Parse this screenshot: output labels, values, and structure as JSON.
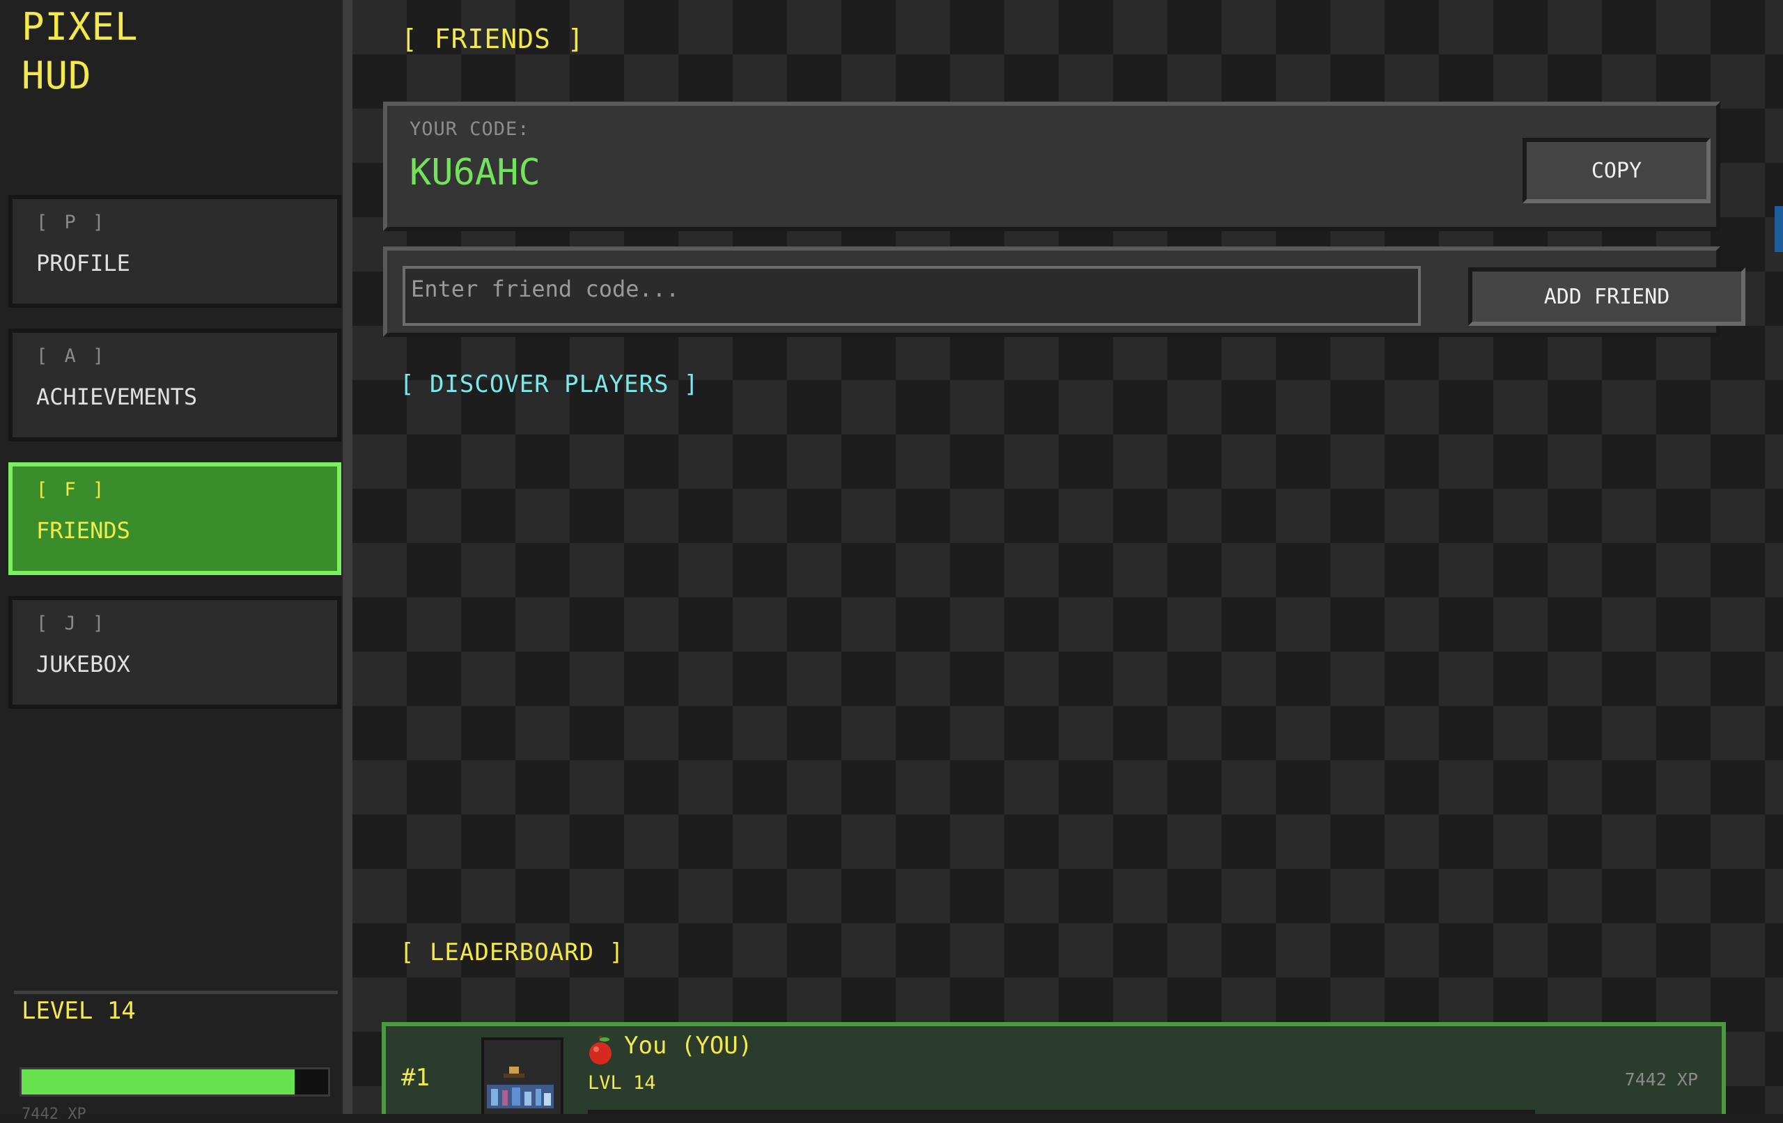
{
  "app": {
    "logo_line1": "PIXEL",
    "logo_line2": "HUD"
  },
  "nav": [
    {
      "key": "[ P ]",
      "label": "PROFILE",
      "active": false
    },
    {
      "key": "[ A ]",
      "label": "ACHIEVEMENTS",
      "active": false
    },
    {
      "key": "[ F ]",
      "label": "FRIENDS",
      "active": true
    },
    {
      "key": "[ J ]",
      "label": "JUKEBOX",
      "active": false
    }
  ],
  "player": {
    "level_label": "LEVEL 14",
    "xp_progress": 0.89,
    "xp_text": "7442 XP"
  },
  "friends": {
    "title": "[ FRIENDS ]",
    "code_caption": "YOUR CODE:",
    "code_value": "KU6AHC",
    "copy_label": "COPY",
    "input_placeholder": "Enter friend code...",
    "add_label": "ADD FRIEND",
    "discover_title": "[ DISCOVER PLAYERS ]",
    "leaderboard_title": "[ LEADERBOARD ]"
  },
  "leaderboard": [
    {
      "rank": "#1",
      "icon": "apple-icon",
      "name": "You (YOU)",
      "level": "LVL 14",
      "xp": "7442 XP"
    }
  ],
  "colors": {
    "accent_yellow": "#f4e94a",
    "accent_green": "#72e35a",
    "accent_cyan": "#7de8ea",
    "active_nav_bg": "#3a8d2b"
  }
}
